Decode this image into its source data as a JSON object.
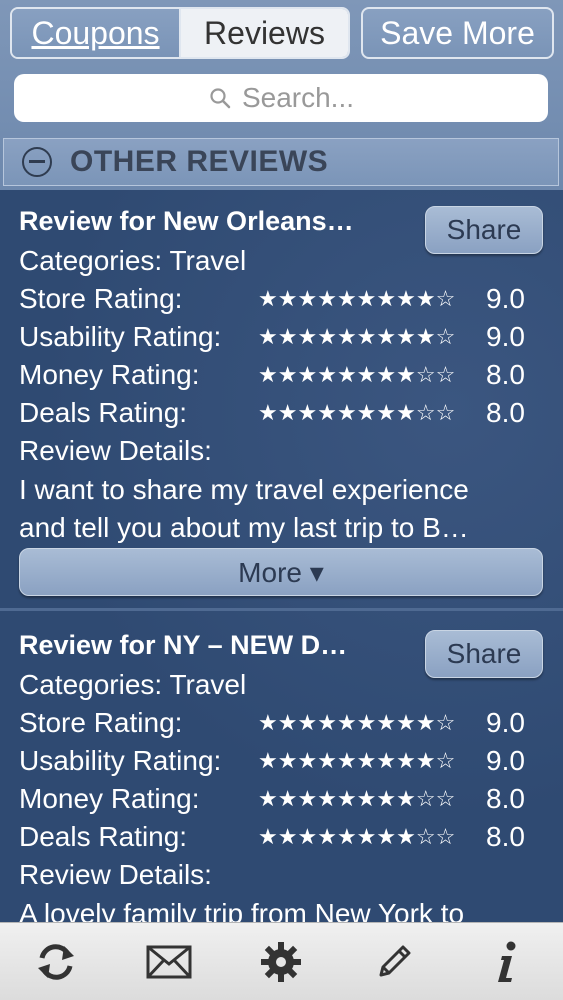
{
  "header": {
    "segments": [
      {
        "label": "Coupons"
      },
      {
        "label": "Reviews"
      }
    ],
    "save_more_label": "Save More",
    "search_placeholder": "Search..."
  },
  "section": {
    "title": "OTHER REVIEWS"
  },
  "reviews": [
    {
      "title": "Review for New Orleans…",
      "share_label": "Share",
      "categories": "Categories: Travel",
      "ratings": [
        {
          "label": "Store Rating:",
          "stars_filled": 9,
          "stars_total": 10,
          "score": "9.0"
        },
        {
          "label": "Usability Rating:",
          "stars_filled": 9,
          "stars_total": 10,
          "score": "9.0"
        },
        {
          "label": "Money Rating:",
          "stars_filled": 8,
          "stars_total": 10,
          "score": "8.0"
        },
        {
          "label": "Deals Rating:",
          "stars_filled": 8,
          "stars_total": 10,
          "score": "8.0"
        }
      ],
      "details_label": "Review Details:",
      "details_line1": "I want to share my travel experience",
      "details_line2": "and tell you about my last trip to B…",
      "more_label": "More ▾"
    },
    {
      "title": "Review for NY – NEW D…",
      "share_label": "Share",
      "categories": "Categories: Travel",
      "ratings": [
        {
          "label": "Store Rating:",
          "stars_filled": 9,
          "stars_total": 10,
          "score": "9.0"
        },
        {
          "label": "Usability Rating:",
          "stars_filled": 9,
          "stars_total": 10,
          "score": "9.0"
        },
        {
          "label": "Money Rating:",
          "stars_filled": 8,
          "stars_total": 10,
          "score": "8.0"
        },
        {
          "label": "Deals Rating:",
          "stars_filled": 8,
          "stars_total": 10,
          "score": "8.0"
        }
      ],
      "details_label": "Review Details:",
      "details_line1": "A lovely family trip from New York to"
    }
  ],
  "tabbar": {
    "icons": [
      "refresh-icon",
      "mail-icon",
      "gear-icon",
      "pencil-icon",
      "info-icon"
    ]
  }
}
